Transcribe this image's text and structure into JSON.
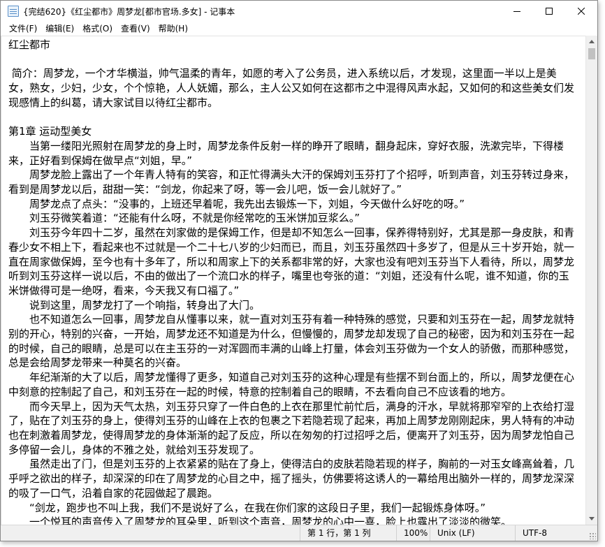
{
  "window": {
    "title": "{完结620}《红尘都市》周梦龙[都市官场.多女] - 记事本",
    "controls": [
      "minimize-icon",
      "maximize-icon",
      "close-icon"
    ]
  },
  "menu": {
    "items": [
      {
        "label": "文件(F)"
      },
      {
        "label": "编辑(E)"
      },
      {
        "label": "格式(O)"
      },
      {
        "label": "查看(V)"
      },
      {
        "label": "帮助(H)"
      }
    ]
  },
  "document": {
    "paragraphs": [
      "红尘都市",
      "",
      " 简介：周梦龙，一个才华横溢，帅气温柔的青年，如愿的考入了公务员，进入系统以后，才发现，这里面一半以上是美女，熟女，少妇，少女，个个惊艳，人人妩媚，那么，主人公又如何在这都市之中混得风声水起，又如何的和这些美女们发现感情上的纠葛，请大家试目以待红尘都市。",
      "",
      "第1章 运动型美女",
      "　　当第一缕阳光照射在周梦龙的身上时，周梦龙条件反射一样的睁开了眼睛，翻身起床，穿好衣服，洗漱完毕，下得楼来，正好看到保姆在做早点“刘姐，早。”",
      "　　周梦龙脸上露出了一个年青人特有的笑容，和正忙得满头大汗的保姆刘玉芬打了个招呼，听到声音，刘玉芬转过身来，看到是周梦龙以后，甜甜一笑：“剑龙，你起来了呀，等一会儿吧，饭一会儿就好了。”",
      "　　周梦龙点了点头：“没事的，上班还早着呢，我先出去锻炼一下，刘姐，今天做什么好吃的呀。”",
      "　　刘玉芬微笑着道：“还能有什么呀，不就是你经常吃的玉米饼加豆浆么。”",
      "　　刘玉芬今年四十二岁，虽然在刘家做的是保姆工作，但是却不知怎么一回事，保养得特别好，尤其是那一身皮肤，和青春少女不相上下，看起来也不过就是一个二十七八岁的少妇而已，而且，刘玉芬虽然四十多岁了，但是从三十岁开始，就一直在周家做保姆，至今也有十多年了，所以和周家上下的关系都非常的好，大家也没有吧刘玉芬当下人看待，所以，周梦龙听到刘玉芬这样一说以后，不由的做出了一个流口水的样子，嘴里也夸张的道：“刘姐，还没有什么呢，谁不知道，你的玉米饼做得可是一绝呀，看来，今天我又有口福了。”",
      "　　说到这里，周梦龙打了一个响指，转身出了大门。",
      "　　也不知道怎么一回事，周梦龙自从懂事以来，就一直对刘玉芬有着一种特殊的感觉，只要和刘玉芬在一起，周梦龙就特别的开心，特别的兴奋，一开始，周梦龙还不知道是为什么，但慢慢的，周梦龙却发现了自己的秘密，因为和刘玉芬在一起的时候，自己的眼睛，总是可以在主玉芬的一对浑圆而丰满的山峰上打量，体会刘玉芬做为一个女人的骄傲，而那种感觉，总是会给周梦龙带来一种莫名的兴奋。",
      "　　年纪渐渐的大了以后，周梦龙懂得了更多，知道自己对刘玉芬的这种心理是有些摆不到台面上的，所以，周梦龙便在心中刻意的控制起了自己，和刘玉芬在一起的时候，特意的控制着自己的眼睛，不去看向自己不应该看的地方。",
      "　　而今天早上，因为天气太热，刘玉芬只穿了一件白色的上衣在那里忙前忙后，满身的汗水，早就将那窄窄的上衣给打湿了，贴在了刘玉芬的身上，使得刘玉芬的山峰在上衣的包裹之下若隐若现了起来，再加上周梦龙刚刚起床，男人特有的冲动也在刺激着周梦龙，使得周梦龙的身体渐渐的起了反应，所以在匆匆的打过招呼之后，便离开了刘玉芬，因为周梦龙怕自己多停留一会儿，身体的不雅之处，就给刘玉芬发现了。",
      "　　虽然走出了门，但是刘玉芬的上衣紧紧的贴在了身上，使得洁白的皮肤若隐若现的样子，胸前的一对玉女峰高耸着，几乎呼之欲出的样子，却深深的印在了周梦龙的心目之中，摇了摇头，仿佛要将这诱人的一幕给甩出脑外一样的，周梦龙深深的吸了一口气，沿着自家的花园做起了晨跑。",
      "　　“剑龙，跑步也不叫上我，我们不是说好了么，在我在你们家的这段日子里，我们一起锻炼身体呀。”",
      "　　一个悦耳的声音传入了周梦龙的耳朵里，听到这个声音，周梦龙的心中一喜，脸上也露出了淡淡的微笑。"
    ]
  },
  "status": {
    "position": "第 1 行，第 1 列",
    "zoom": "100%",
    "line_ending": "Unix (LF)",
    "encoding": "UTF-8"
  }
}
